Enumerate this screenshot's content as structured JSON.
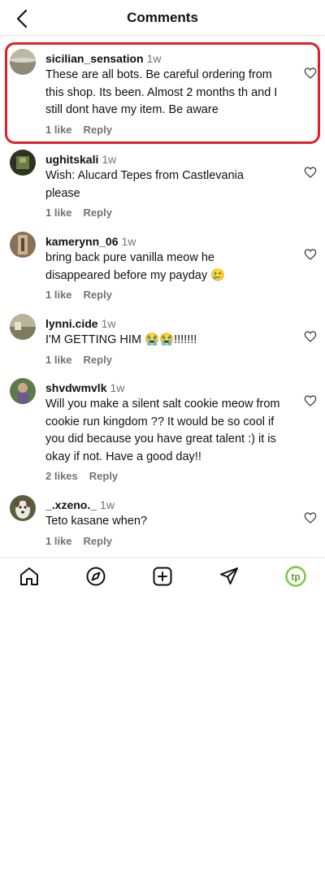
{
  "header": {
    "title": "Comments"
  },
  "comments": [
    {
      "username": "sicilian_sensation",
      "time": "1w",
      "text": "These are all bots. Be careful ordering from this shop. Its been. Almost 2 months th and I still dont have my item. Be aware",
      "likes": "1 like",
      "reply": "Reply"
    },
    {
      "username": "ughitskali",
      "time": "1w",
      "text": "Wish: Alucard Tepes from Castlevania please",
      "likes": "1 like",
      "reply": "Reply"
    },
    {
      "username": "kamerynn_06",
      "time": "1w",
      "text": "bring back pure vanilla meow he disappeared before my payday 🥲",
      "likes": "1 like",
      "reply": "Reply"
    },
    {
      "username": "lynni.cide",
      "time": "1w",
      "text": "I'M GETTING HIM 😭😭!!!!!!!",
      "likes": "1 like",
      "reply": "Reply"
    },
    {
      "username": "shvdwmvlk",
      "time": "1w",
      "text": "Will you make a silent salt cookie meow from cookie run kingdom ?? It would be so cool if you did because you have great talent :) it is okay if not. Have a good day!!",
      "likes": "2 likes",
      "reply": "Reply"
    },
    {
      "username": "_.xzeno._",
      "time": "1w",
      "text": "Teto kasane when?",
      "likes": "1 like",
      "reply": "Reply"
    }
  ],
  "colors": {
    "highlight": "#e0202e",
    "meta": "#737373",
    "profile_green": "#7ac943"
  },
  "tabbar": {
    "items": [
      "home-icon",
      "explore-icon",
      "create-icon",
      "direct-icon",
      "profile-icon"
    ],
    "profile_initials": "tp"
  }
}
